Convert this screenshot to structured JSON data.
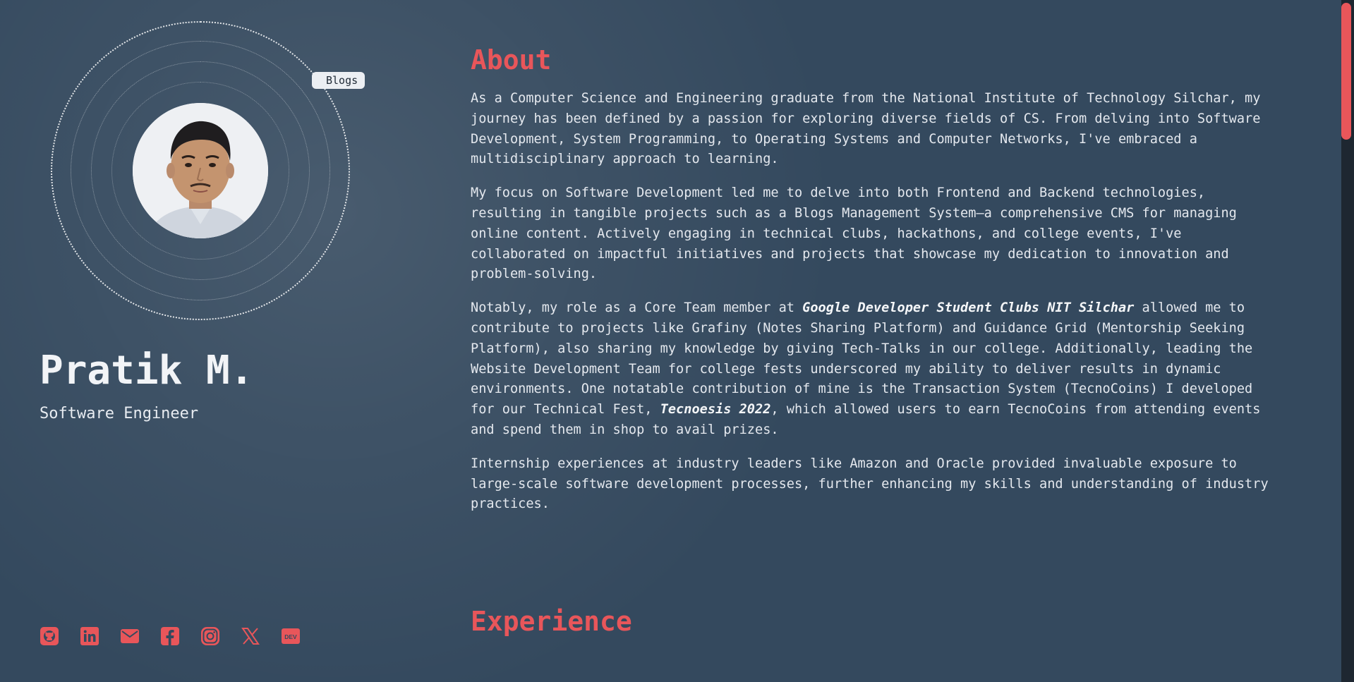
{
  "profile": {
    "name": "Pratik M.",
    "role": "Software Engineer",
    "orbit_tag": "Blogs",
    "avatar_alt": "profile photo"
  },
  "social": [
    {
      "name": "github",
      "icon": "github-icon"
    },
    {
      "name": "linkedin",
      "icon": "linkedin-icon"
    },
    {
      "name": "email",
      "icon": "mail-icon"
    },
    {
      "name": "facebook",
      "icon": "facebook-icon"
    },
    {
      "name": "instagram",
      "icon": "instagram-icon"
    },
    {
      "name": "x",
      "icon": "x-icon"
    },
    {
      "name": "dev",
      "icon": "dev-icon",
      "label": "DEV"
    }
  ],
  "about": {
    "title": "About",
    "p1": "As a Computer Science and Engineering graduate from the National Institute of Technology Silchar, my journey has been defined by a passion for exploring diverse fields of CS. From delving into Software Development, System Programming, to Operating Systems and Computer Networks, I've embraced a multidisciplinary approach to learning.",
    "p2": "My focus on Software Development led me to delve into both Frontend and Backend technologies, resulting in tangible projects such as a Blogs Management System—a comprehensive CMS for managing online content. Actively engaging in technical clubs, hackathons, and college events, I've collaborated on impactful initiatives and projects that showcase my dedication to innovation and problem-solving.",
    "p3_a": "Notably, my role as a Core Team member at ",
    "p3_em1": "Google Developer Student Clubs NIT Silchar",
    "p3_b": " allowed me to contribute to projects like Grafiny (Notes Sharing Platform) and Guidance Grid (Mentorship Seeking Platform), also sharing my knowledge by giving Tech-Talks in our college. Additionally, leading the Website Development Team for college fests underscored my ability to deliver results in dynamic environments. One notatable contribution of mine is the Transaction System (TecnoCoins) I developed for our Technical Fest, ",
    "p3_em2": "Tecnoesis 2022",
    "p3_c": ", which allowed users to earn TecnoCoins from attending events and spend them in shop to avail prizes.",
    "p4": "Internship experiences at industry leaders like Amazon and Oracle provided invaluable exposure to large-scale software development processes, further enhancing my skills and understanding of industry practices."
  },
  "experience": {
    "title": "Experience"
  },
  "colors": {
    "background": "#34495e",
    "accent": "#e8565a",
    "text": "#e4e8ee"
  }
}
